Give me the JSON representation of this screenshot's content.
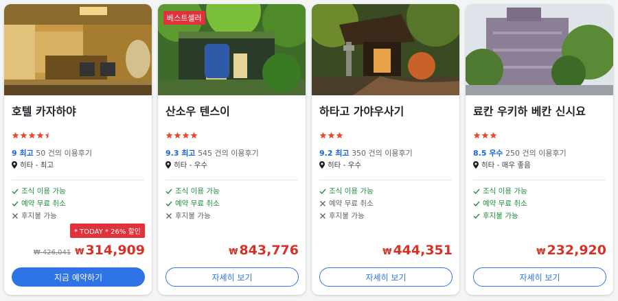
{
  "hotels": [
    {
      "name": "호텔 카자하야",
      "badge": "",
      "stars": 4.5,
      "score": "9 최고",
      "reviews": "50 건의 이용후기",
      "location": "히타 - 최고",
      "amenities": [
        {
          "label": "조식 이용 가능",
          "available": true
        },
        {
          "label": "예약 무료 취소",
          "available": true
        },
        {
          "label": "후지불 가능",
          "available": false
        }
      ],
      "promo": "* TODAY * 26% 할인",
      "old_price": "₩ 426,041",
      "currency": "₩",
      "price": "314,909",
      "button": "지금 예약하기",
      "button_style": "primary"
    },
    {
      "name": "산소우 텐스이",
      "badge": "베스트셀러",
      "stars": 4,
      "score": "9.3 최고",
      "reviews": "545 건의 이용후기",
      "location": "히타 - 우수",
      "amenities": [
        {
          "label": "조식 이용 가능",
          "available": true
        },
        {
          "label": "예약 무료 취소",
          "available": true
        },
        {
          "label": "후지불 가능",
          "available": false
        }
      ],
      "promo": "",
      "old_price": "",
      "currency": "₩",
      "price": "843,776",
      "button": "자세히 보기",
      "button_style": "outline"
    },
    {
      "name": "하타고 가야우사기",
      "badge": "",
      "stars": 3,
      "score": "9.2 최고",
      "reviews": "350 건의 이용후기",
      "location": "히타 - 우수",
      "amenities": [
        {
          "label": "조식 이용 가능",
          "available": true
        },
        {
          "label": "예약 무료 취소",
          "available": false
        },
        {
          "label": "후지불 가능",
          "available": false
        }
      ],
      "promo": "",
      "old_price": "",
      "currency": "₩",
      "price": "444,351",
      "button": "자세히 보기",
      "button_style": "outline"
    },
    {
      "name": "료칸 우키하 베칸 신시요",
      "badge": "",
      "stars": 3,
      "score": "8.5 우수",
      "reviews": "250 건의 이용후기",
      "location": "히타 - 매우 좋음",
      "amenities": [
        {
          "label": "조식 이용 가능",
          "available": true
        },
        {
          "label": "예약 무료 취소",
          "available": true
        },
        {
          "label": "후지불 가능",
          "available": true
        }
      ],
      "promo": "",
      "old_price": "",
      "currency": "₩",
      "price": "232,920",
      "button": "자세히 보기",
      "button_style": "outline"
    }
  ],
  "colors": {
    "accent": "#2f74e6",
    "price": "#d93025",
    "badge": "#e0323a",
    "star": "#e8492f",
    "available": "#1e8e3e"
  }
}
